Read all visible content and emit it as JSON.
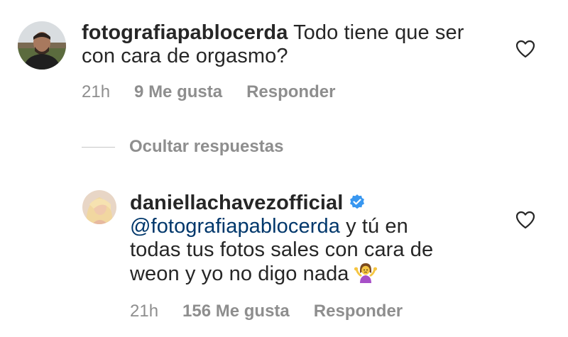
{
  "comments": [
    {
      "username": "fotografiapablocerda",
      "text_line1": "Todo tiene que ser",
      "text_line2": "con cara de orgasmo?",
      "time": "21h",
      "likes": "9 Me gusta",
      "reply_label": "Responder"
    }
  ],
  "replies_toggle": {
    "label": "Ocultar respuestas"
  },
  "replies": [
    {
      "username": "daniellachavezofficial",
      "verified": true,
      "mention": "@fotografiapablocerda",
      "text_after_mention": "y tú en",
      "text_line2": "todas tus fotos sales con cara de",
      "text_line3": "weon y yo no digo nada",
      "emoji": "person-shrugging-emoji",
      "time": "21h",
      "likes": "156 Me gusta",
      "reply_label": "Responder"
    }
  ],
  "icons": {
    "heart": "heart-icon",
    "verified": "verified-badge-icon"
  },
  "colors": {
    "text": "#262626",
    "secondary": "#8e8e8e",
    "mention": "#00376b",
    "verified": "#3897f0"
  }
}
